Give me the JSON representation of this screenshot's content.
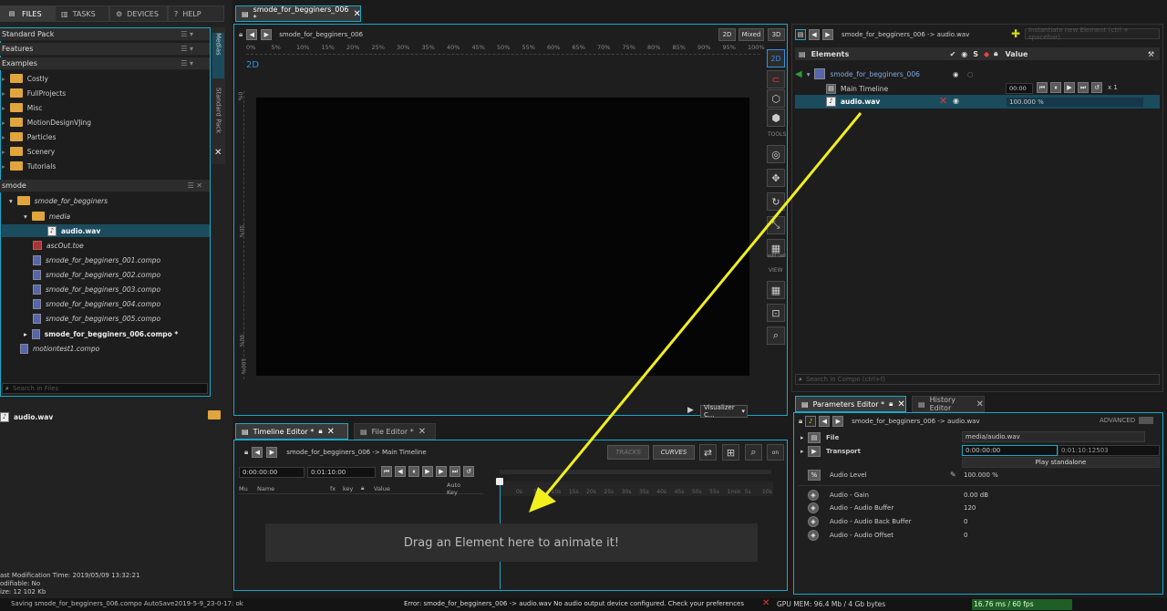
{
  "top_tabs": [
    "FILES",
    "TASKS",
    "DEVICES",
    "HELP"
  ],
  "packs": [
    "Standard Pack",
    "Features",
    "Examples"
  ],
  "examples": [
    "Costly",
    "FullProjects",
    "Misc",
    "MotionDesignVJing",
    "Particles",
    "Scenery",
    "Tutorials"
  ],
  "smode_header": "smode",
  "tree": {
    "root": "smode_for_begginers",
    "media": "media",
    "audio": "audio.wav",
    "asc": "ascOut.toe",
    "composA": "smode_for_begginers_001.compo",
    "composB": "smode_for_begginers_002.compo",
    "composC": "smode_for_begginers_003.compo",
    "composD": "smode_for_begginers_004.compo",
    "composE": "smode_for_begginers_005.compo",
    "active": "smode_for_begginers_006.compo *",
    "motion": "motiontest1.compo"
  },
  "side_tabs": [
    "Medias",
    "Standard Pack"
  ],
  "search_files": "Search in Files",
  "file_info": {
    "name": "audio.wav",
    "modified": "ast Modification Time: 2019/05/09 13:32:21",
    "modifiable": "odifiable: No",
    "size": "ize: 12 102 Kb"
  },
  "doc_tab": "smode_for_begginers_006 *",
  "viewport": {
    "path": "smode_for_begginers_006",
    "modes": [
      "2D",
      "Mixed",
      "3D"
    ],
    "label2d": "2D",
    "ruler": [
      "0%",
      "5%",
      "10%",
      "15%",
      "20%",
      "25%",
      "30%",
      "35%",
      "40%",
      "45%",
      "50%",
      "55%",
      "60%",
      "65%",
      "70%",
      "75%",
      "80%",
      "85%",
      "90%",
      "95%",
      "100%"
    ],
    "vruler": [
      "0%",
      "50%",
      "90%",
      "100%"
    ],
    "visualizer": "Visualizer C...",
    "tools": "TOOLS",
    "view": "VIEW",
    "editcell": "edit cell"
  },
  "timeline": {
    "tab": "Timeline Editor *",
    "file_tab": "File Editor *",
    "path": "smode_for_begginers_006 -> Main Timeline",
    "tracks": "TRACKS",
    "curves": "CURVES",
    "start": "0:00:00:00",
    "end": "0:01:10:00",
    "cols": [
      "Mu",
      "Name",
      "fx",
      "key",
      "Value",
      "Auto Key"
    ],
    "drag_hint": "Drag an Element here to animate it!",
    "ticks": [
      "0s",
      "5s",
      "10s",
      "15s",
      "20s",
      "25s",
      "30s",
      "35s",
      "40s",
      "45s",
      "50s",
      "55s",
      "1min",
      "5s",
      "10s"
    ]
  },
  "elements": {
    "path": "smode_for_begginers_006 -> audio.wav",
    "search": "Instantiate new Element (ctrl + spacebar)",
    "col_name": "Elements",
    "col_value": "Value",
    "items": [
      "smode_for_begginers_006",
      "Main Timeline",
      "audio.wav"
    ],
    "time": "00:00",
    "loop": "x 1",
    "audio_value": "100.000 %",
    "search_compo": "Search in Compo (ctrl+f)"
  },
  "params": {
    "tab": "Parameters Editor *",
    "history": "History Editor",
    "path": "smode_for_begginers_006 -> audio.wav",
    "advanced": "ADVANCED",
    "rows": [
      {
        "k": "File",
        "v": "media/audio.wav"
      },
      {
        "k": "Transport",
        "v": "0:00:00:00",
        "v2": "0:01:10:12503"
      },
      {
        "k": "",
        "v": "Play standalone"
      },
      {
        "k": "Audio Level",
        "v": "100.000 %"
      },
      {
        "k": "Audio - Gain",
        "v": "0.00 dB"
      },
      {
        "k": "Audio - Audio Buffer",
        "v": "120"
      },
      {
        "k": "Audio - Audio Back Buffer",
        "v": "0"
      },
      {
        "k": "Audio - Audio Offset",
        "v": "0"
      }
    ]
  },
  "status": {
    "left": "Saving smode_for_begginers_006.compo AutoSave2019-5-9_23-0-17: ok",
    "error": "Error: smode_for_begginers_006 -> audio.wav No audio output device configured. Check your preferences",
    "gpu": "GPU MEM: 96.4 Mb / 4 Gb bytes",
    "fps": "16.76 ms / 60 fps"
  },
  "colors": {
    "accent": "#17a9c9",
    "selected": "#1b4c5e",
    "arrow": "#f2ef1f",
    "ok": "#2e9a3b"
  }
}
